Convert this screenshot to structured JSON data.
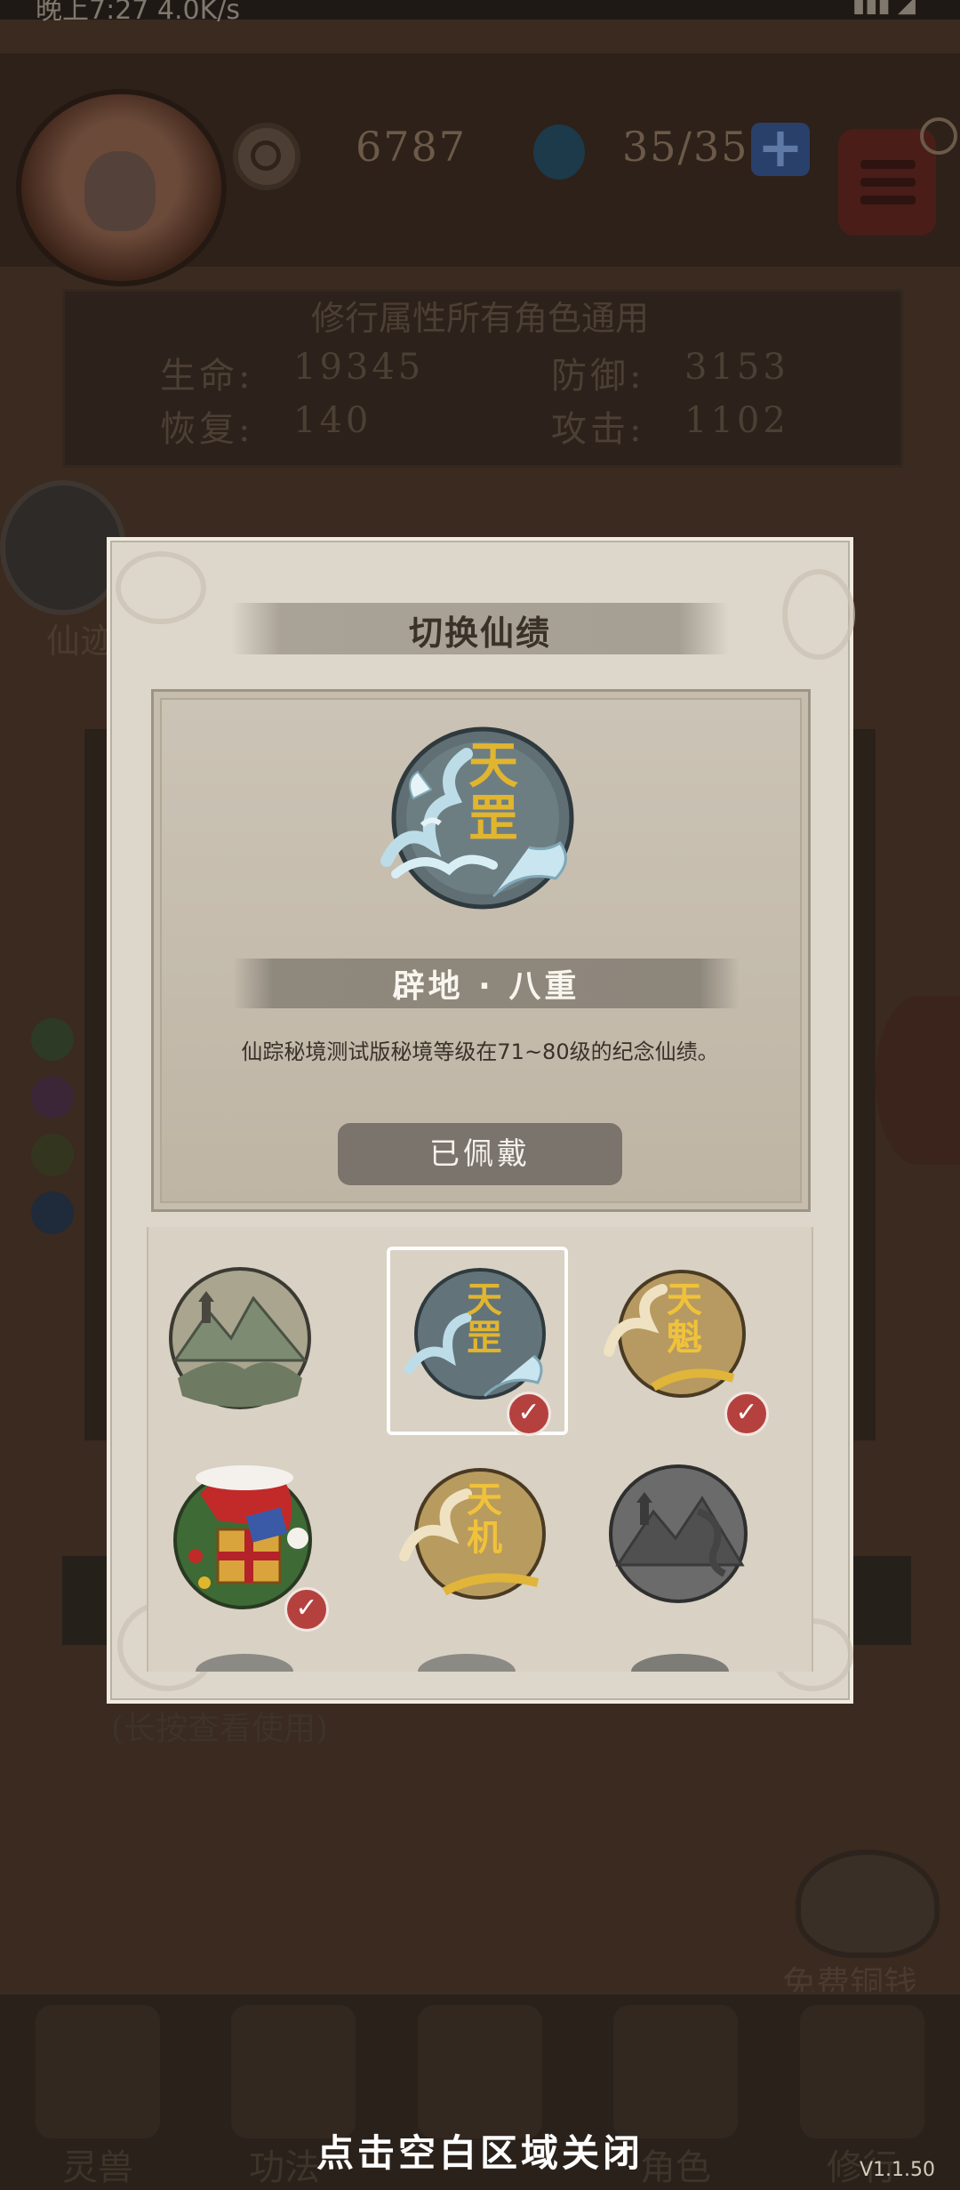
{
  "status_bar": {
    "time": "晚上7:27",
    "network": "4.0K/s"
  },
  "currency": {
    "coins": "6787",
    "stamina": "35/35"
  },
  "attributes": {
    "title": "修行属性所有角色通用",
    "hp_label": "生命:",
    "hp_value": "19345",
    "def_label": "防御:",
    "def_value": "3153",
    "rec_label": "恢复:",
    "rec_value": "140",
    "atk_label": "攻击:",
    "atk_value": "1102"
  },
  "background": {
    "left_emblem_label": "仙迹",
    "bottom_hint": "(长按查看使用)",
    "free_coins_label": "免费铜钱"
  },
  "modal": {
    "title": "切换仙绩",
    "selected": {
      "emblem_char_top": "天",
      "emblem_char_bottom": "罡",
      "name": "辟地 · 八重",
      "description": "仙踪秘境测试版秘境等级在71~80级的纪念仙绩。",
      "status_button": "已佩戴"
    },
    "grid": [
      {
        "id": "mountain",
        "chars": "",
        "checked": false,
        "selected": false
      },
      {
        "id": "tiangang",
        "chars": "天罡",
        "checked": true,
        "selected": true
      },
      {
        "id": "tiankui",
        "chars": "天魁",
        "checked": true,
        "selected": false
      },
      {
        "id": "christmas",
        "chars": "",
        "checked": true,
        "selected": false
      },
      {
        "id": "tianji",
        "chars": "天机",
        "checked": false,
        "selected": false
      },
      {
        "id": "grey-mountain",
        "chars": "",
        "checked": false,
        "selected": false
      }
    ]
  },
  "nav": {
    "items": [
      "灵兽",
      "功法",
      "",
      "角色",
      "修行"
    ]
  },
  "close_hint": "点击空白区域关闭",
  "version": "V1.1.50",
  "colors": {
    "modal_bg": "#ddd7cb",
    "button_gray": "#7a746c",
    "check_red": "#b5413e",
    "gold": "#d6a22a"
  }
}
